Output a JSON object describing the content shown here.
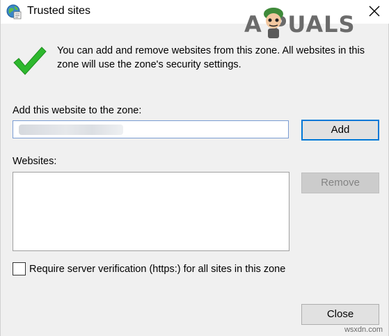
{
  "window": {
    "title": "Trusted sites",
    "title_icon": "globe-icon",
    "close_icon": "close-icon"
  },
  "watermark": {
    "text": "A PUALS"
  },
  "info": {
    "icon": "checkmark-icon",
    "text": "You can add and remove websites from this zone. All websites in this zone will use the zone's security settings."
  },
  "add_site": {
    "label": "Add this website to the zone:",
    "value": "",
    "button_label": "Add"
  },
  "websites": {
    "label": "Websites:",
    "items": [],
    "remove_label": "Remove"
  },
  "https_option": {
    "label": "Require server verification (https:) for all sites in this zone",
    "checked": false
  },
  "footer": {
    "close_label": "Close",
    "credit": "wsxdn.com"
  },
  "colors": {
    "background": "#f0f0f0",
    "check_green": "#2eb82e",
    "focus_blue": "#0078d7"
  }
}
